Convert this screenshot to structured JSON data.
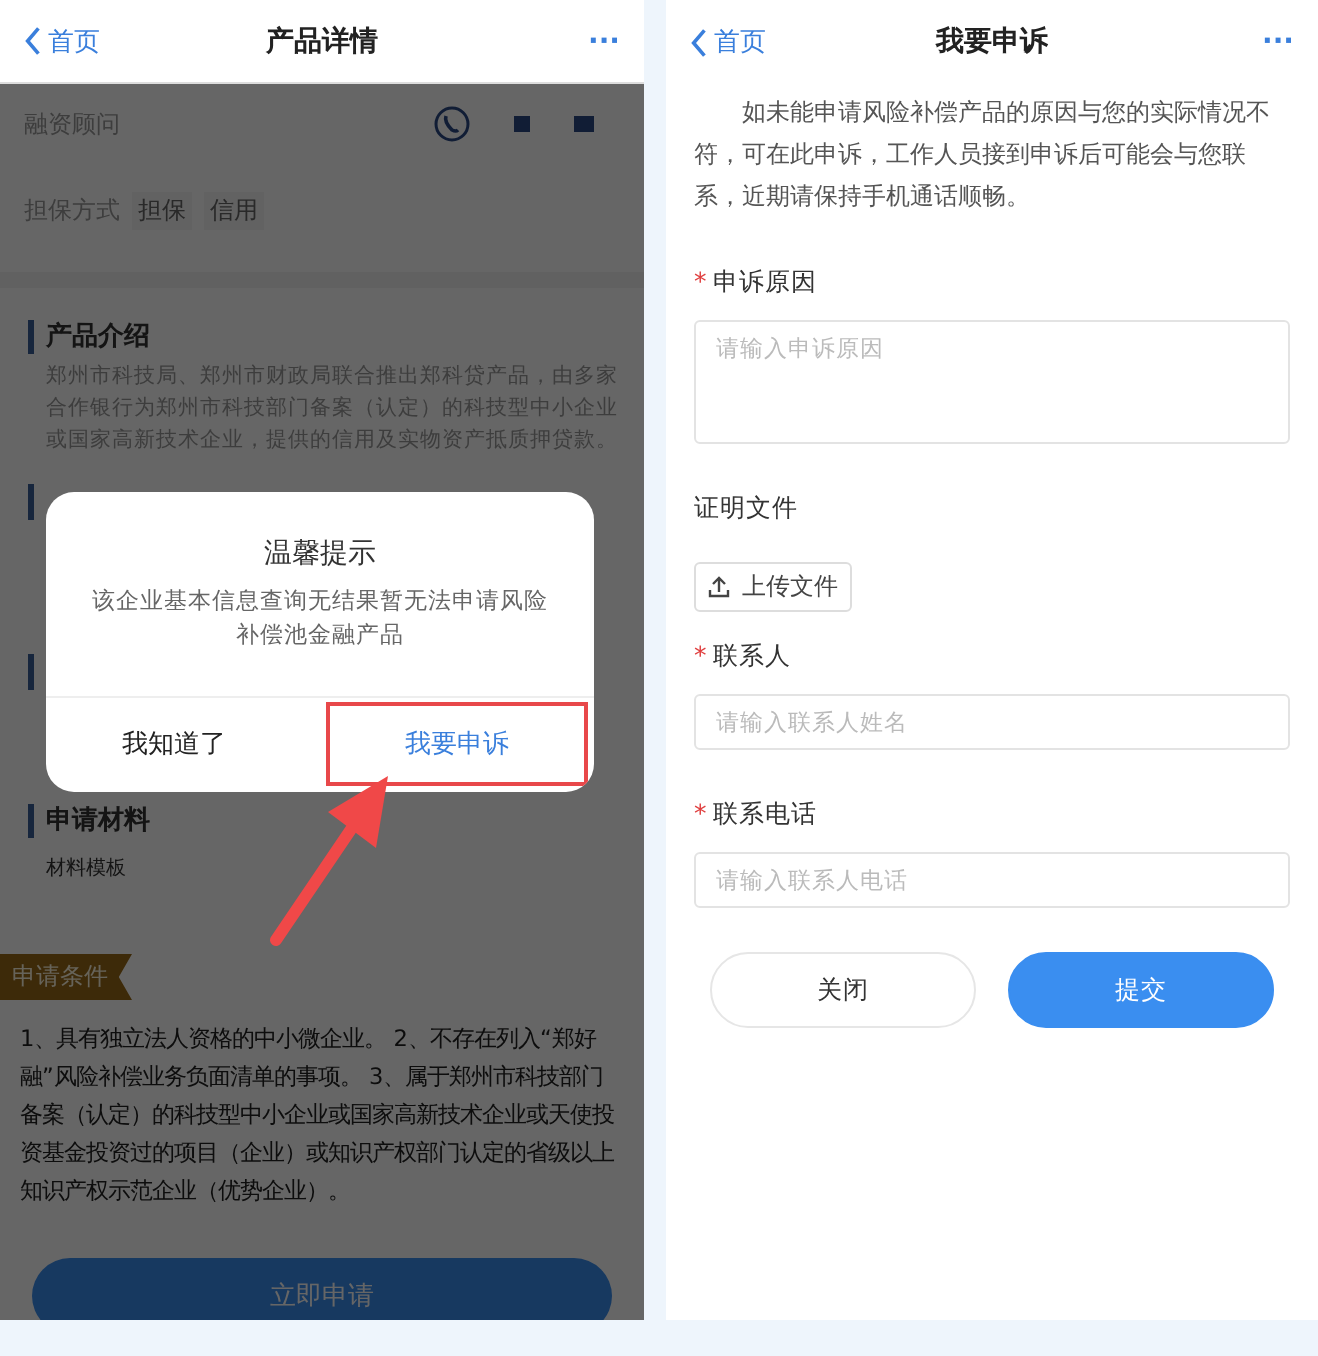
{
  "left": {
    "header": {
      "back": "首页",
      "title": "产品详情",
      "more": "···"
    },
    "advisor": {
      "label": "融资顾问"
    },
    "guarantee": {
      "label": "担保方式",
      "tags": [
        "担保",
        "信用"
      ]
    },
    "intro": {
      "title": "产品介绍",
      "text": "郑州市科技局、郑州市财政局联合推出郑科贷产品，由多家合作银行为郑州市科技部门备案（认定）的科技型中小企业或国家高新技术企业，提供的信用及实物资产抵质押贷款。"
    },
    "materials": {
      "title": "申请材料",
      "link": "材料模板"
    },
    "conditions": {
      "tag": "申请条件",
      "text": "1、具有独立法人资格的中小微企业。 2、不存在列入“郑好融”风险补偿业务负面清单的事项。 3、属于郑州市科技部门备案（认定）的科技型中小企业或国家高新技术企业或天使投资基金投资过的项目（企业）或知识产权部门认定的省级以上知识产权示范企业（优势企业）。"
    },
    "apply_button": "立即申请",
    "dialog": {
      "title": "温馨提示",
      "message": "该企业基本信息查询无结果暂无法申请风险补偿池金融产品",
      "buttons": [
        {
          "label": "我知道了",
          "highlighted": false
        },
        {
          "label": "我要申诉",
          "highlighted": true
        }
      ]
    }
  },
  "right": {
    "header": {
      "back": "首页",
      "title": "我要申诉",
      "more": "···"
    },
    "required_mark": "*",
    "intro": "如未能申请风险补偿产品的原因与您的实际情况不符，可在此申诉，工作人员接到申诉后可能会与您联系，近期请保持手机通话顺畅。",
    "fields": [
      {
        "kind": "textarea",
        "label": "申诉原因",
        "required": true,
        "placeholder": "请输入申诉原因"
      },
      {
        "kind": "upload",
        "label": "证明文件",
        "required": false,
        "button": "上传文件"
      },
      {
        "kind": "input",
        "label": "联系人",
        "required": true,
        "placeholder": "请输入联系人姓名"
      },
      {
        "kind": "input",
        "label": "联系电话",
        "required": true,
        "placeholder": "请输入联系人电话"
      }
    ],
    "buttons": [
      {
        "label": "关闭",
        "primary": false
      },
      {
        "label": "提交",
        "primary": true
      }
    ]
  }
}
